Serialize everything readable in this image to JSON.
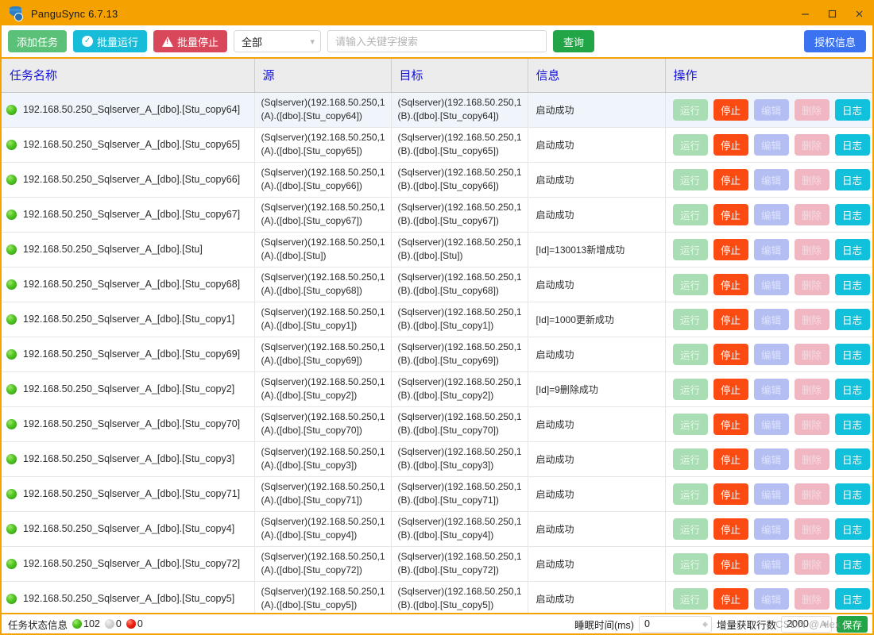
{
  "window": {
    "title": "PanguSync 6.7.13",
    "icon": "database-icon",
    "controls": {
      "minimize": "minimize-icon",
      "maximize": "maximize-icon",
      "close": "close-icon"
    },
    "accent_color": "#f5a201"
  },
  "toolbar": {
    "add_task": "添加任务",
    "run_all": "批量运行",
    "run_all_icon": "circle-check-icon",
    "stop_all": "批量停止",
    "stop_all_icon": "warning-triangle-icon",
    "filter_value": "全部",
    "filter_options": [
      "全部"
    ],
    "search_placeholder": "请输入关键字搜索",
    "search_value": "",
    "query": "查询",
    "license": "授权信息",
    "colors": {
      "add": "#5cc178",
      "run_all": "#17bdd8",
      "stop_all": "#d9475b",
      "query": "#21a546",
      "license": "#3a72f0"
    }
  },
  "table": {
    "header_color": "#1414d8",
    "columns": [
      "任务名称",
      "源",
      "目标",
      "信息",
      "操作"
    ],
    "ops": {
      "run": "运行",
      "stop": "停止",
      "edit": "编辑",
      "delete": "删除",
      "log": "日志"
    },
    "op_colors": {
      "run": "#a9ddb4",
      "stop": "#fb4b12",
      "edit": "#b4bef3",
      "delete": "#f0b6c2",
      "log": "#11c0da"
    },
    "rows": [
      {
        "status": "running",
        "name": "192.168.50.250_Sqlserver_A_[dbo].[Stu_copy64]",
        "src_line1": "(Sqlserver)(192.168.50.250,1",
        "src_line2": "(A).([dbo].[Stu_copy64])",
        "dst_line1": "(Sqlserver)(192.168.50.250,1",
        "dst_line2": "(B).([dbo].[Stu_copy64])",
        "info": "启动成功",
        "selected": true
      },
      {
        "status": "running",
        "name": "192.168.50.250_Sqlserver_A_[dbo].[Stu_copy65]",
        "src_line1": "(Sqlserver)(192.168.50.250,1",
        "src_line2": "(A).([dbo].[Stu_copy65])",
        "dst_line1": "(Sqlserver)(192.168.50.250,1",
        "dst_line2": "(B).([dbo].[Stu_copy65])",
        "info": "启动成功",
        "selected": false
      },
      {
        "status": "running",
        "name": "192.168.50.250_Sqlserver_A_[dbo].[Stu_copy66]",
        "src_line1": "(Sqlserver)(192.168.50.250,1",
        "src_line2": "(A).([dbo].[Stu_copy66])",
        "dst_line1": "(Sqlserver)(192.168.50.250,1",
        "dst_line2": "(B).([dbo].[Stu_copy66])",
        "info": "启动成功",
        "selected": false
      },
      {
        "status": "running",
        "name": "192.168.50.250_Sqlserver_A_[dbo].[Stu_copy67]",
        "src_line1": "(Sqlserver)(192.168.50.250,1",
        "src_line2": "(A).([dbo].[Stu_copy67])",
        "dst_line1": "(Sqlserver)(192.168.50.250,1",
        "dst_line2": "(B).([dbo].[Stu_copy67])",
        "info": "启动成功",
        "selected": false
      },
      {
        "status": "running",
        "name": "192.168.50.250_Sqlserver_A_[dbo].[Stu]",
        "src_line1": "(Sqlserver)(192.168.50.250,1",
        "src_line2": "(A).([dbo].[Stu])",
        "dst_line1": "(Sqlserver)(192.168.50.250,1",
        "dst_line2": "(B).([dbo].[Stu])",
        "info": "[Id]=130013新增成功",
        "selected": false
      },
      {
        "status": "running",
        "name": "192.168.50.250_Sqlserver_A_[dbo].[Stu_copy68]",
        "src_line1": "(Sqlserver)(192.168.50.250,1",
        "src_line2": "(A).([dbo].[Stu_copy68])",
        "dst_line1": "(Sqlserver)(192.168.50.250,1",
        "dst_line2": "(B).([dbo].[Stu_copy68])",
        "info": "启动成功",
        "selected": false
      },
      {
        "status": "running",
        "name": "192.168.50.250_Sqlserver_A_[dbo].[Stu_copy1]",
        "src_line1": "(Sqlserver)(192.168.50.250,1",
        "src_line2": "(A).([dbo].[Stu_copy1])",
        "dst_line1": "(Sqlserver)(192.168.50.250,1",
        "dst_line2": "(B).([dbo].[Stu_copy1])",
        "info": "[Id]=1000更新成功",
        "selected": false
      },
      {
        "status": "running",
        "name": "192.168.50.250_Sqlserver_A_[dbo].[Stu_copy69]",
        "src_line1": "(Sqlserver)(192.168.50.250,1",
        "src_line2": "(A).([dbo].[Stu_copy69])",
        "dst_line1": "(Sqlserver)(192.168.50.250,1",
        "dst_line2": "(B).([dbo].[Stu_copy69])",
        "info": "启动成功",
        "selected": false
      },
      {
        "status": "running",
        "name": "192.168.50.250_Sqlserver_A_[dbo].[Stu_copy2]",
        "src_line1": "(Sqlserver)(192.168.50.250,1",
        "src_line2": "(A).([dbo].[Stu_copy2])",
        "dst_line1": "(Sqlserver)(192.168.50.250,1",
        "dst_line2": "(B).([dbo].[Stu_copy2])",
        "info": "[Id]=9删除成功",
        "selected": false
      },
      {
        "status": "running",
        "name": "192.168.50.250_Sqlserver_A_[dbo].[Stu_copy70]",
        "src_line1": "(Sqlserver)(192.168.50.250,1",
        "src_line2": "(A).([dbo].[Stu_copy70])",
        "dst_line1": "(Sqlserver)(192.168.50.250,1",
        "dst_line2": "(B).([dbo].[Stu_copy70])",
        "info": "启动成功",
        "selected": false
      },
      {
        "status": "running",
        "name": "192.168.50.250_Sqlserver_A_[dbo].[Stu_copy3]",
        "src_line1": "(Sqlserver)(192.168.50.250,1",
        "src_line2": "(A).([dbo].[Stu_copy3])",
        "dst_line1": "(Sqlserver)(192.168.50.250,1",
        "dst_line2": "(B).([dbo].[Stu_copy3])",
        "info": "启动成功",
        "selected": false
      },
      {
        "status": "running",
        "name": "192.168.50.250_Sqlserver_A_[dbo].[Stu_copy71]",
        "src_line1": "(Sqlserver)(192.168.50.250,1",
        "src_line2": "(A).([dbo].[Stu_copy71])",
        "dst_line1": "(Sqlserver)(192.168.50.250,1",
        "dst_line2": "(B).([dbo].[Stu_copy71])",
        "info": "启动成功",
        "selected": false
      },
      {
        "status": "running",
        "name": "192.168.50.250_Sqlserver_A_[dbo].[Stu_copy4]",
        "src_line1": "(Sqlserver)(192.168.50.250,1",
        "src_line2": "(A).([dbo].[Stu_copy4])",
        "dst_line1": "(Sqlserver)(192.168.50.250,1",
        "dst_line2": "(B).([dbo].[Stu_copy4])",
        "info": "启动成功",
        "selected": false
      },
      {
        "status": "running",
        "name": "192.168.50.250_Sqlserver_A_[dbo].[Stu_copy72]",
        "src_line1": "(Sqlserver)(192.168.50.250,1",
        "src_line2": "(A).([dbo].[Stu_copy72])",
        "dst_line1": "(Sqlserver)(192.168.50.250,1",
        "dst_line2": "(B).([dbo].[Stu_copy72])",
        "info": "启动成功",
        "selected": false
      },
      {
        "status": "running",
        "name": "192.168.50.250_Sqlserver_A_[dbo].[Stu_copy5]",
        "src_line1": "(Sqlserver)(192.168.50.250,1",
        "src_line2": "(A).([dbo].[Stu_copy5])",
        "dst_line1": "(Sqlserver)(192.168.50.250,1",
        "dst_line2": "(B).([dbo].[Stu_copy5])",
        "info": "启动成功",
        "selected": false
      }
    ]
  },
  "statusbar": {
    "label": "任务状态信息",
    "count_running": "102",
    "count_idle": "0",
    "count_error": "0",
    "sleep_label": "睡眠时间(ms)",
    "sleep_value": "0",
    "rows_label": "增量获取行数",
    "rows_value": "2000",
    "save": "保存",
    "watermark": "CSDN @Alex"
  }
}
